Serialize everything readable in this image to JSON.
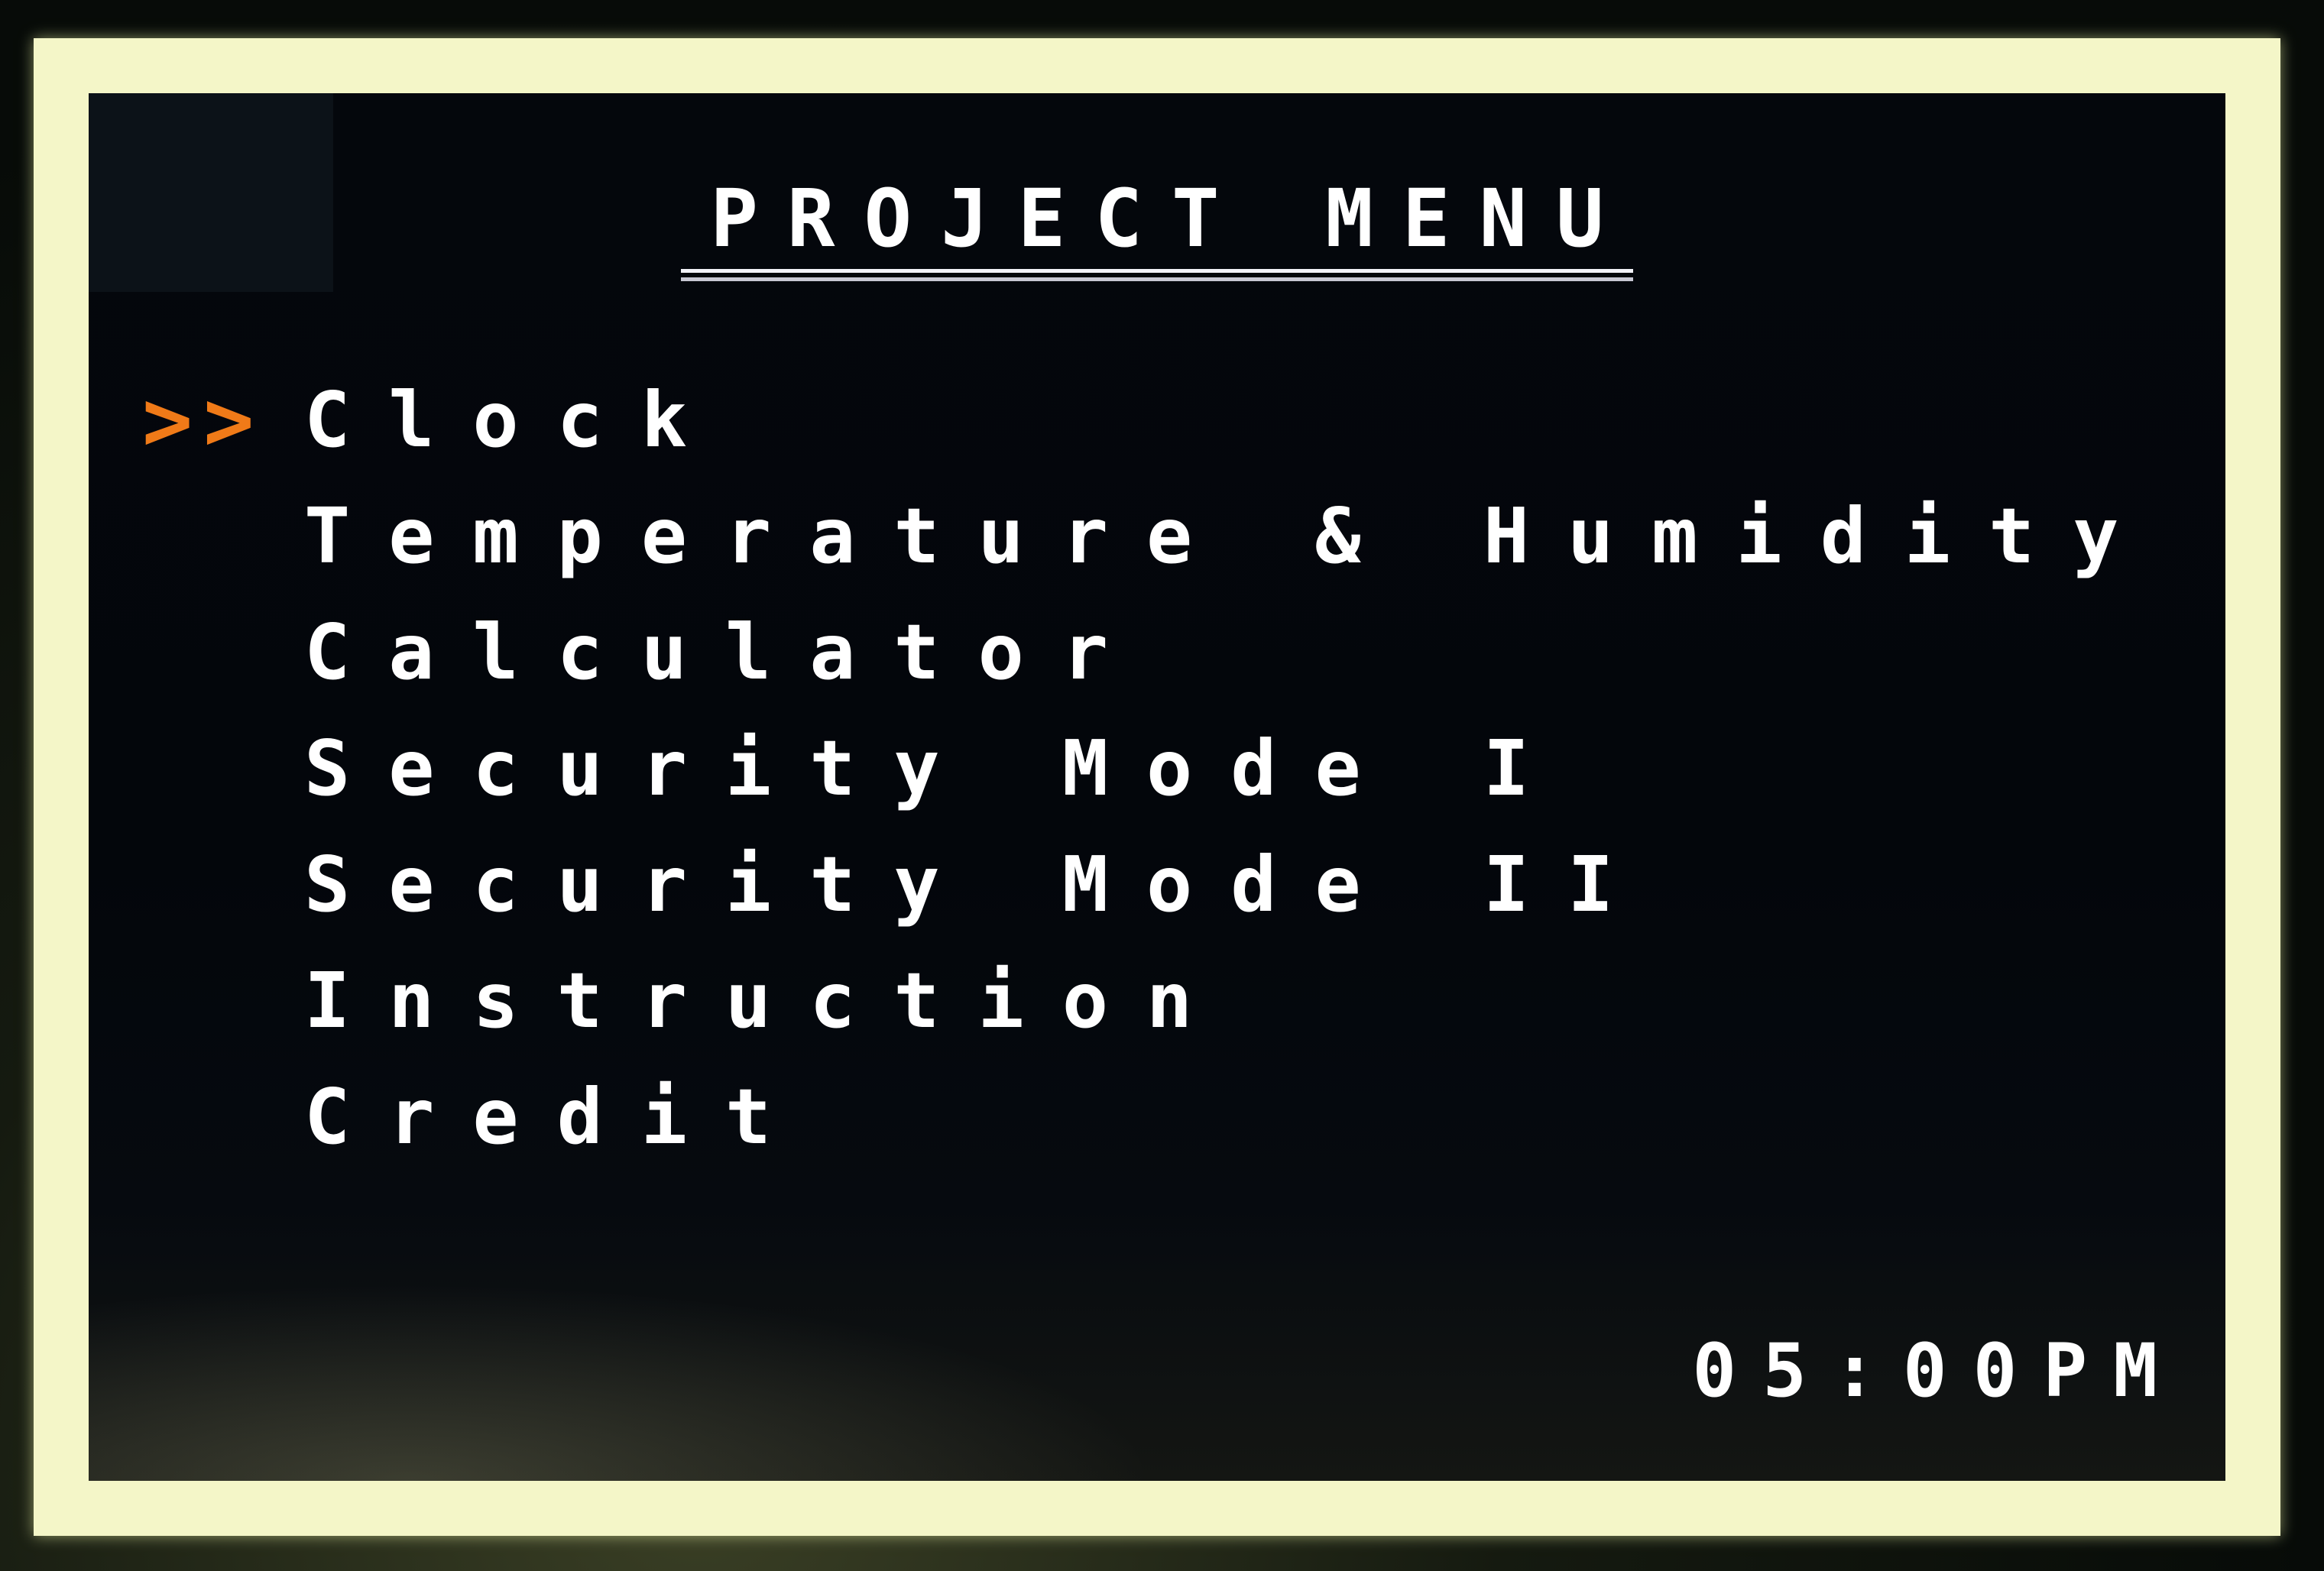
{
  "title": "PROJECT MENU",
  "cursor_glyph": ">>",
  "selected_index": 0,
  "menu": {
    "items": [
      {
        "label": "Clock"
      },
      {
        "label": "Temperature & Humidity"
      },
      {
        "label": "Calculator"
      },
      {
        "label": "Security Mode I"
      },
      {
        "label": "Security Mode II"
      },
      {
        "label": "Instruction"
      },
      {
        "label": "Credit"
      }
    ]
  },
  "status": {
    "time": "05:00PM"
  },
  "colors": {
    "background": "#04070c",
    "text": "#ffffff",
    "cursor": "#f07a18",
    "frame": "#f4f6c8"
  }
}
